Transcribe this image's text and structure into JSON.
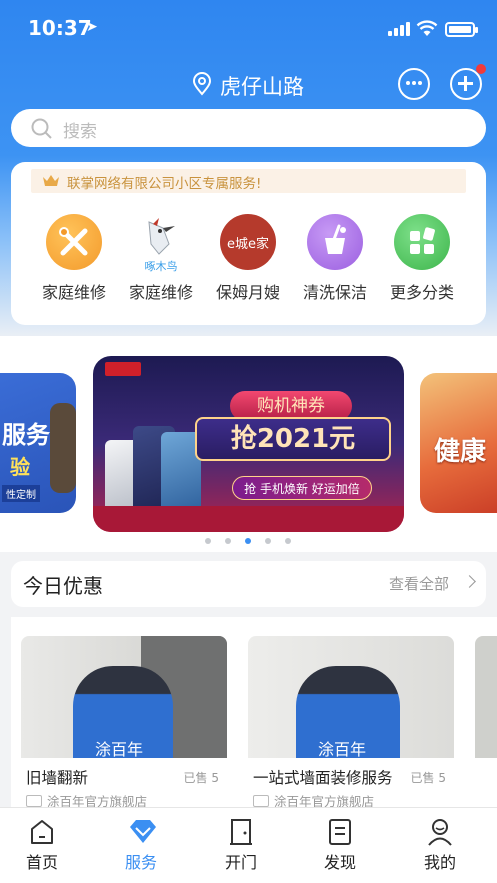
{
  "status_bar": {
    "time": "10:37"
  },
  "header": {
    "location": "虎仔山路"
  },
  "search": {
    "placeholder": "搜索"
  },
  "services": {
    "notice": "联掌网络有限公司小区专属服务!",
    "items": [
      {
        "label": "家庭维修",
        "icon": "wrench-screwdriver-icon",
        "color": "#f5a23a"
      },
      {
        "label": "家庭维修",
        "icon": "woodpecker-logo-icon",
        "logo_text": "啄木鸟",
        "color": "#3a9ee8"
      },
      {
        "label": "保姆月嫂",
        "icon": "ecity-home-logo-icon",
        "logo_text": "e城e家",
        "color": "#c0392b"
      },
      {
        "label": "清洗保洁",
        "icon": "cleaning-bucket-icon",
        "color": "#a86ee6"
      },
      {
        "label": "更多分类",
        "icon": "grid-more-icon",
        "color": "#4dc05a"
      }
    ]
  },
  "banner": {
    "main": {
      "line1": "购机神券",
      "line2": "抢2021元",
      "line3": "抢 手机焕新 好运加倍"
    },
    "left_peek": {
      "line1": "服务",
      "line2": "验",
      "line3": "性定制"
    },
    "right_peek": {
      "line1": "健康"
    },
    "carousel": {
      "count": 5,
      "active_index": 2
    }
  },
  "deals": {
    "title": "今日优惠",
    "see_all": "查看全部",
    "products": [
      {
        "name": "旧墙翻新",
        "sold": "已售 5",
        "shop": "涂百年官方旗舰店",
        "brand": "涂百年"
      },
      {
        "name": "一站式墙面装修服务",
        "sold": "已售 5",
        "shop": "涂百年官方旗舰店",
        "brand": "涂百年"
      }
    ]
  },
  "tabbar": {
    "active": "服务",
    "tabs": [
      {
        "label": "首页",
        "icon": "home-icon"
      },
      {
        "label": "服务",
        "icon": "diamond-icon"
      },
      {
        "label": "开门",
        "icon": "door-icon"
      },
      {
        "label": "发现",
        "icon": "document-icon"
      },
      {
        "label": "我的",
        "icon": "profile-icon"
      }
    ]
  },
  "colors": {
    "primary": "#3b8ff2",
    "notice_text": "#c9933e",
    "badge": "#f23a3a"
  }
}
